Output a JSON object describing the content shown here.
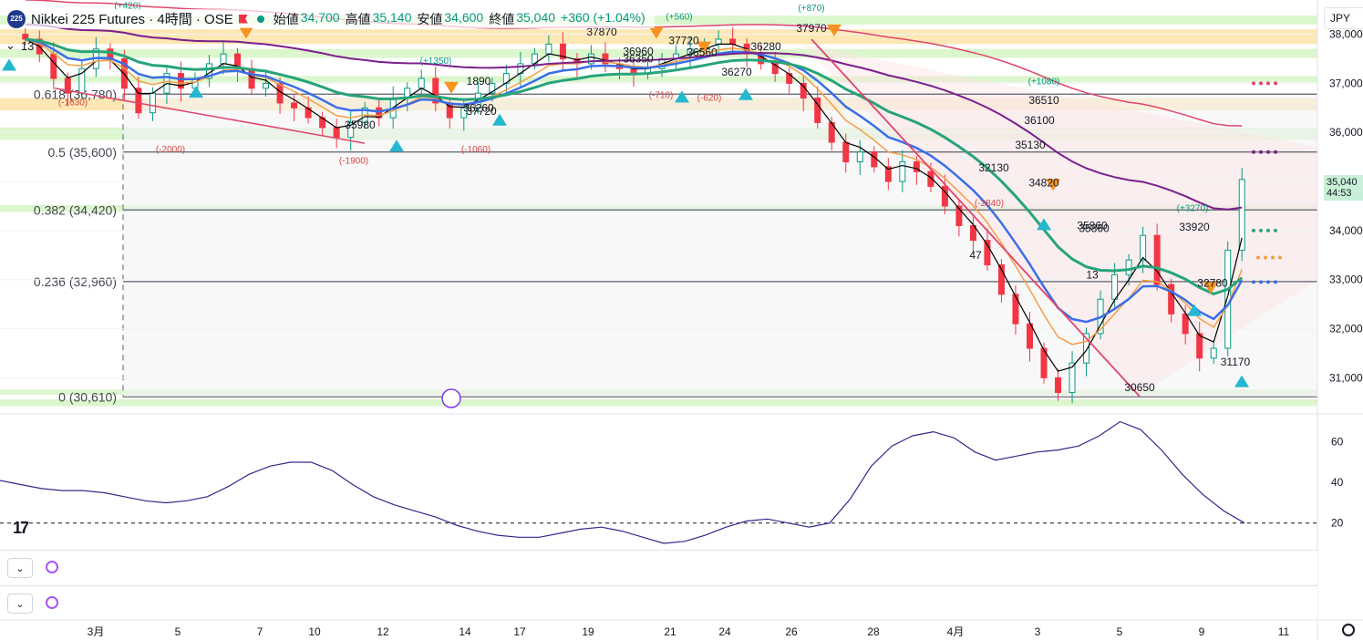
{
  "header": {
    "symbol_badge": "225",
    "title": "Nikkei 225 Futures · 4時間 · OSE",
    "ohlc": [
      {
        "label": "始値",
        "value": "34,700"
      },
      {
        "label": "高値",
        "value": "35,140"
      },
      {
        "label": "安値",
        "value": "34,600"
      },
      {
        "label": "終値",
        "value": "35,040"
      },
      {
        "label": "",
        "value": "+360 (+1.04%)"
      }
    ],
    "interval_value": "13"
  },
  "currency": "JPY",
  "last_price": {
    "price": "35,040",
    "countdown": "44:53"
  },
  "colors": {
    "up": "#089981",
    "down": "#f23645",
    "ema_fast": "#000000",
    "ema_orange": "#f59e42",
    "ema_blue": "#3b6ee8",
    "ema_green": "#27a47a",
    "ema_purple": "#7b1f8c",
    "ema_pink": "#e0456b",
    "zone_green": "#d6f5c4",
    "zone_orange": "#fde3a7",
    "osc": "#2e2a8c"
  },
  "chart_data": {
    "type": "candlestick",
    "y_axis": {
      "ticks": [
        31000,
        32000,
        33000,
        34000,
        35000,
        36000,
        37000,
        38000
      ],
      "labels": [
        "31,000",
        "32,000",
        "33,000",
        "34,000",
        "35,000",
        "36,000",
        "37,000",
        "38,000"
      ],
      "range": [
        30300,
        38550
      ]
    },
    "x_axis": {
      "labels": [
        "3月",
        "5",
        "7",
        "10",
        "12",
        "14",
        "17",
        "19",
        "21",
        "24",
        "26",
        "28",
        "4月",
        "3",
        "5",
        "9",
        "11"
      ]
    },
    "fib_levels": [
      {
        "label": "0.618 (36,780)",
        "value": 36780
      },
      {
        "label": "0.5 (35,600)",
        "value": 35600
      },
      {
        "label": "0.382 (34,420)",
        "value": 34420
      },
      {
        "label": "0.236 (32,960)",
        "value": 32960
      },
      {
        "label": "0 (30,610)",
        "value": 30610
      }
    ],
    "closes": [
      37900,
      37600,
      37100,
      36800,
      37300,
      37700,
      37500,
      36900,
      36400,
      36800,
      37200,
      36900,
      37100,
      37400,
      37600,
      37300,
      36900,
      37000,
      36600,
      36500,
      36300,
      36100,
      35900,
      36200,
      36500,
      36300,
      36700,
      36900,
      37100,
      36600,
      36300,
      36500,
      36800,
      37000,
      37200,
      37400,
      37600,
      37800,
      37500,
      37400,
      37600,
      37400,
      37300,
      37200,
      37300,
      37500,
      37600,
      37700,
      37800,
      37900,
      37800,
      37600,
      37400,
      37200,
      37000,
      36700,
      36200,
      35800,
      35400,
      35600,
      35300,
      35000,
      35400,
      35200,
      34900,
      34500,
      34100,
      33800,
      33300,
      32700,
      32100,
      31600,
      31000,
      30700,
      31300,
      31900,
      32600,
      33100,
      33400,
      33900,
      32900,
      32300,
      31900,
      31400,
      31600,
      33600,
      35040
    ],
    "sub_annotations": [
      "37870",
      "37720",
      "37970",
      "36510",
      "36100",
      "34820",
      "33920",
      "35860",
      "32780",
      "31170",
      "30650",
      "32130",
      "35130",
      "36350",
      "37720",
      "36280",
      "36560",
      "36960",
      "36260",
      "35980",
      "36270",
      "35860",
      "1890",
      "47",
      "13"
    ],
    "red_annotations": [
      "(-1630)",
      "(-2000)",
      "(-1900)",
      "(-1060)",
      "(-710)",
      "(-620)",
      "(-2840)",
      "(+1350)",
      "(+870)",
      "(+560)",
      "(+1080)",
      "(+3270)",
      "(+420)"
    ],
    "oscillator": {
      "ticks": [
        20,
        40,
        60
      ],
      "labels": [
        "20",
        "40",
        "60"
      ],
      "range": [
        10,
        72
      ],
      "values": [
        41,
        39,
        37,
        36,
        36,
        35,
        33,
        31,
        30,
        31,
        33,
        38,
        44,
        48,
        50,
        50,
        46,
        39,
        33,
        29,
        26,
        23,
        19,
        16,
        14,
        13,
        13,
        15,
        17,
        18,
        16,
        13,
        10,
        11,
        14,
        18,
        21,
        22,
        20,
        18,
        20,
        32,
        48,
        58,
        63,
        65,
        62,
        55,
        51,
        53,
        55,
        56,
        58,
        63,
        70,
        66,
        56,
        44,
        34,
        26,
        20
      ]
    }
  },
  "panes": [
    {
      "collapse_label": "⌄"
    },
    {
      "collapse_label": "⌄"
    }
  ],
  "logo": "17"
}
